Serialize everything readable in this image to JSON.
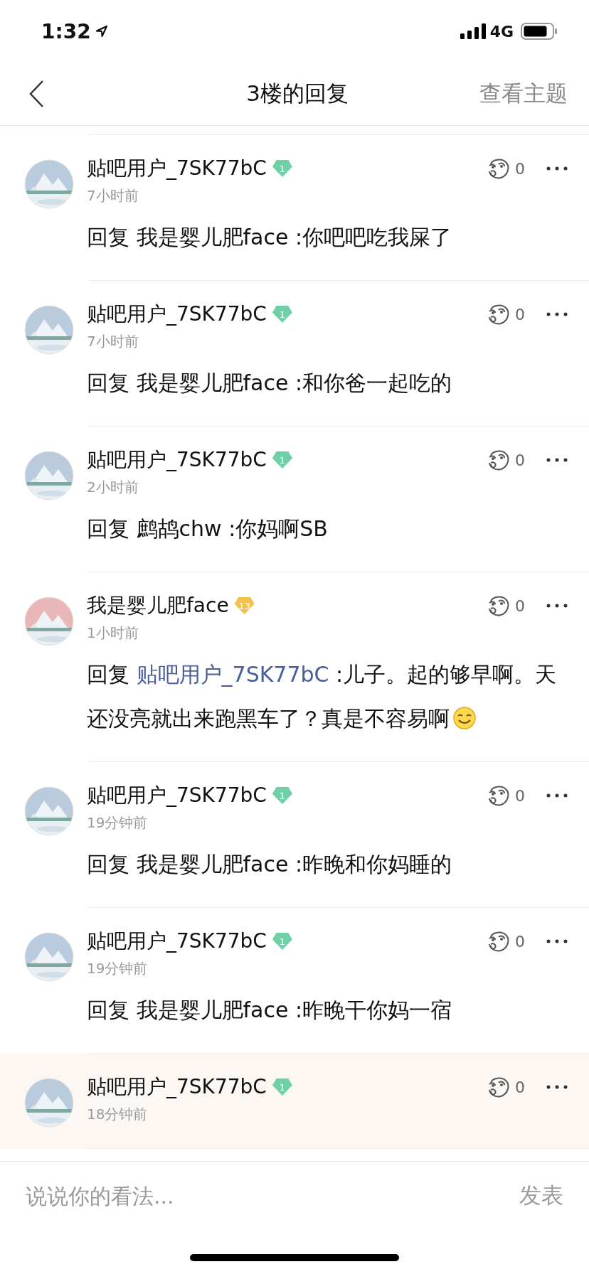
{
  "status_bar": {
    "time": "1:32",
    "network": "4G"
  },
  "nav": {
    "title": "3楼的回复",
    "action": "查看主题"
  },
  "replies": [
    {
      "user": "贴吧用户_7SK77bC",
      "level": "1",
      "color": "#6fd0a8",
      "time": "7小时前",
      "prefix": "回复",
      "reply_to": "我是婴儿肥face",
      "reply_to_link": false,
      "text": ":你吧吧吃我屎了",
      "emoji": false,
      "likes": "0",
      "highlighted": false
    },
    {
      "user": "贴吧用户_7SK77bC",
      "level": "1",
      "color": "#6fd0a8",
      "time": "7小时前",
      "prefix": "回复",
      "reply_to": "我是婴儿肥face",
      "reply_to_link": false,
      "text": ":和你爸一起吃的",
      "emoji": false,
      "likes": "0",
      "highlighted": false
    },
    {
      "user": "贴吧用户_7SK77bC",
      "level": "1",
      "color": "#6fd0a8",
      "time": "2小时前",
      "prefix": "回复",
      "reply_to": "鹧鸪chw",
      "reply_to_link": false,
      "text": ":你妈啊SB",
      "emoji": false,
      "likes": "0",
      "highlighted": false
    },
    {
      "user": "我是婴儿肥face",
      "level": "13",
      "color": "#f2c14e",
      "time": "1小时前",
      "prefix": "回复",
      "reply_to": "贴吧用户_7SK77bC",
      "reply_to_link": true,
      "text": ":儿子。起的够早啊。天还没亮就出来跑黑车了？真是不容易啊",
      "emoji": true,
      "likes": "0",
      "highlighted": false
    },
    {
      "user": "贴吧用户_7SK77bC",
      "level": "1",
      "color": "#6fd0a8",
      "time": "19分钟前",
      "prefix": "回复",
      "reply_to": "我是婴儿肥face",
      "reply_to_link": false,
      "text": ":昨晚和你妈睡的",
      "emoji": false,
      "likes": "0",
      "highlighted": false
    },
    {
      "user": "贴吧用户_7SK77bC",
      "level": "1",
      "color": "#6fd0a8",
      "time": "19分钟前",
      "prefix": "回复",
      "reply_to": "我是婴儿肥face",
      "reply_to_link": false,
      "text": ":昨晚干你妈一宿",
      "emoji": false,
      "likes": "0",
      "highlighted": false
    },
    {
      "user": "贴吧用户_7SK77bC",
      "level": "1",
      "color": "#6fd0a8",
      "time": "18分钟前",
      "likes": "0",
      "highlighted": true
    }
  ],
  "composer": {
    "placeholder": "说说你的看法...",
    "submit": "发表"
  }
}
